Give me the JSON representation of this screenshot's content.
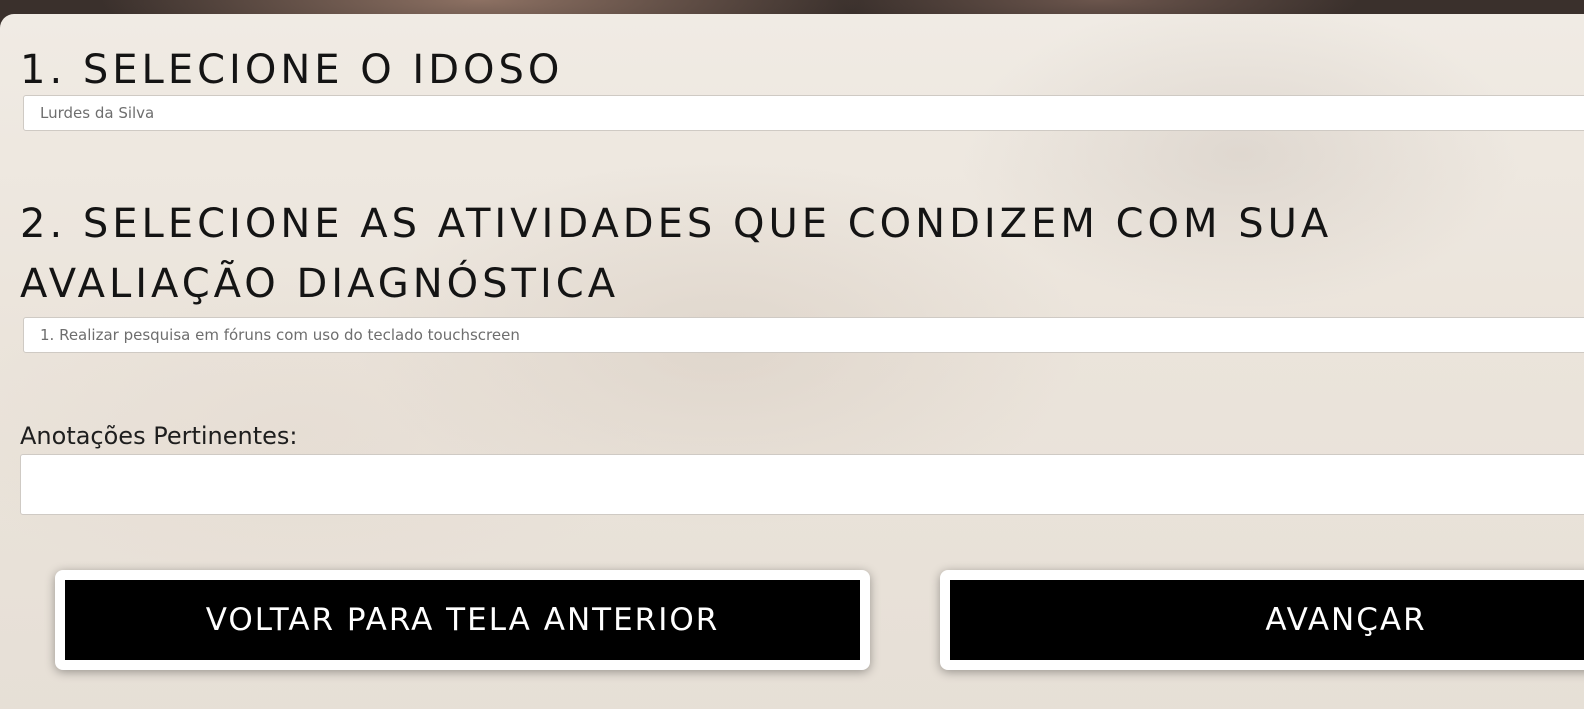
{
  "section1": {
    "title": "1. SELECIONE O IDOSO",
    "selected_value": "Lurdes da Silva"
  },
  "section2": {
    "title": "2. SELECIONE AS ATIVIDADES QUE CONDIZEM COM SUA AVALIAÇÃO DIAGNÓSTICA",
    "selected_value": "1. Realizar pesquisa em fóruns com uso do teclado touchscreen"
  },
  "notes": {
    "label": "Anotações Pertinentes:",
    "value": ""
  },
  "actions": {
    "back_label": "VOLTAR PARA TELA ANTERIOR",
    "next_label": "AVANÇAR"
  }
}
